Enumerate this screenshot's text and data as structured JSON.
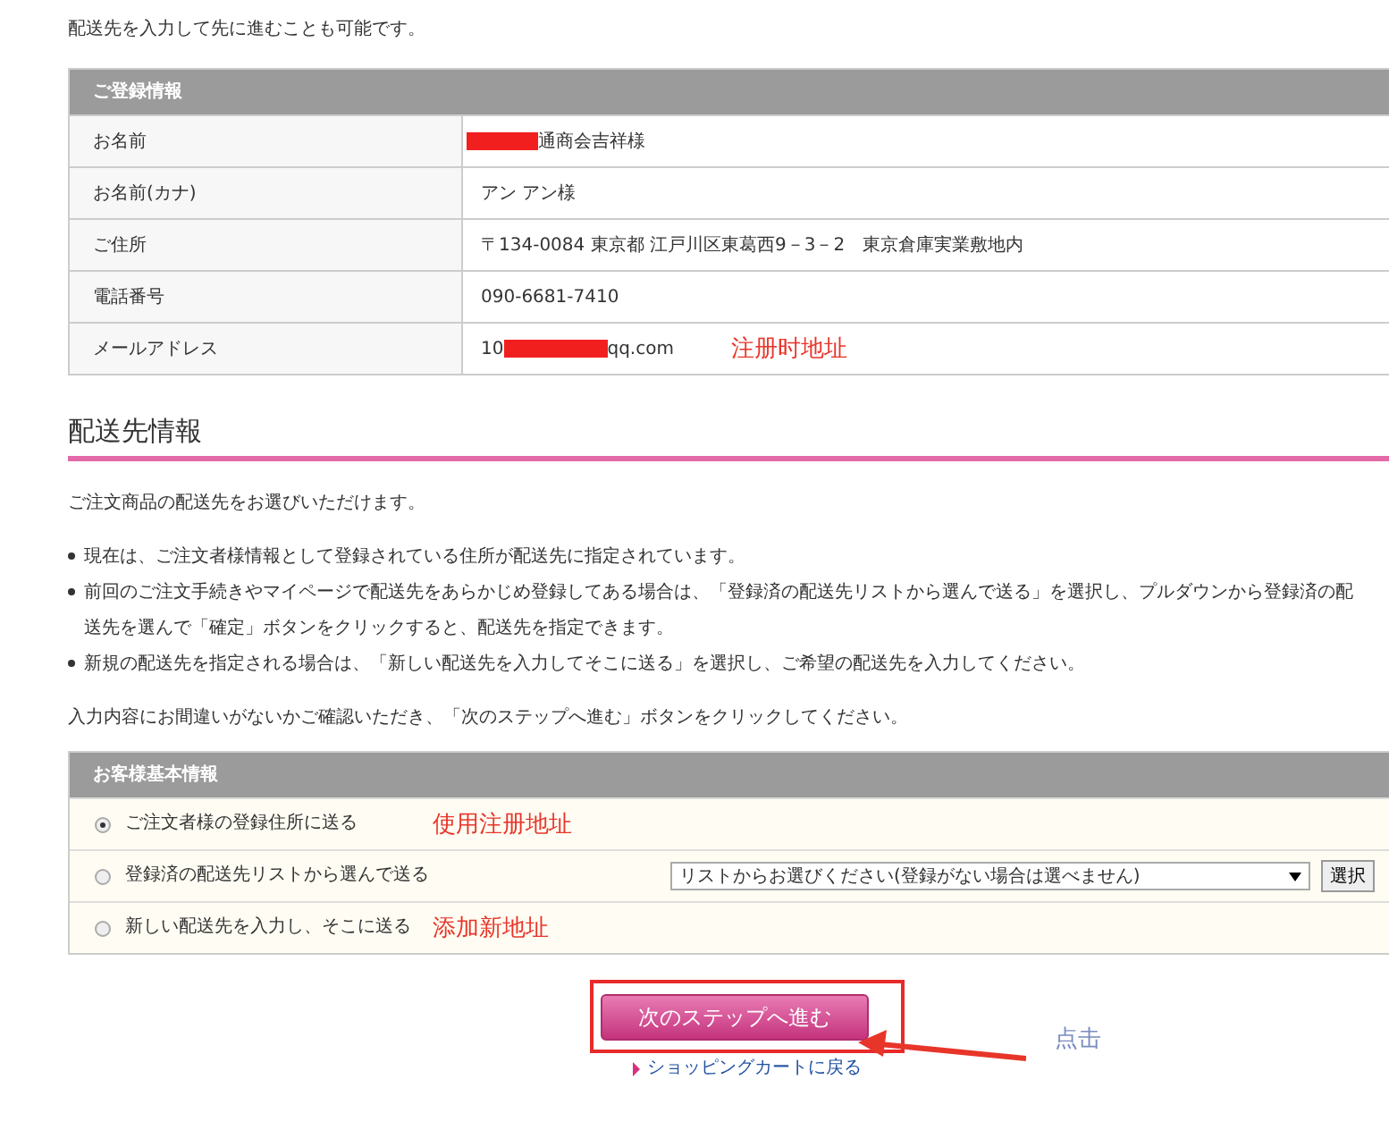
{
  "intro": "配送先を入力して先に進むことも可能です。",
  "registration": {
    "title": "ご登録情報",
    "rows": [
      {
        "label": "お名前",
        "redacted": true,
        "value": "通商会吉祥様"
      },
      {
        "label": "お名前(カナ)",
        "redacted": false,
        "value": "アン アン様"
      },
      {
        "label": "ご住所",
        "redacted": false,
        "value": "〒134-0084 東京都 江戸川区東葛西9－3－2　東京倉庫実業敷地内"
      },
      {
        "label": "電話番号",
        "redacted": false,
        "value": "090-6681-7410"
      },
      {
        "label": "メールアドレス",
        "prefix": "10",
        "redacted": true,
        "value": "qq.com",
        "note": "注册时地址"
      }
    ]
  },
  "shipping": {
    "heading": "配送先情報",
    "lead": "ご注文商品の配送先をお選びいただけます。",
    "bullets": [
      {
        "lines": [
          "現在は、ご注文者様情報として登録されている住所が配送先に指定されています。"
        ]
      },
      {
        "lines": [
          "前回のご注文手続きやマイページで配送先をあらかじめ登録してある場合は、「登録済の配送先リストから選んで送る」を選択し、プルダウンから登録済の配",
          "送先を選んで「確定」ボタンをクリックすると、配送先を指定できます。"
        ]
      },
      {
        "lines": [
          "新規の配送先を指定される場合は、「新しい配送先を入力してそこに送る」を選択し、ご希望の配送先を入力してください。"
        ]
      }
    ],
    "confirm": "入力内容にお間違いがないかご確認いただき、「次のステップへ進む」ボタンをクリックしてください。"
  },
  "options": {
    "title": "お客様基本情報",
    "items": [
      {
        "kind": "plain",
        "label": "ご注文者様の登録住所に送る",
        "selected": true,
        "note": "使用注册地址"
      },
      {
        "kind": "list",
        "label": "登録済の配送先リストから選んで送る",
        "selected": false,
        "dropdown": "リストからお選びください(登録がない場合は選べません)",
        "button": "選択"
      },
      {
        "kind": "plain",
        "label": "新しい配送先を入力し、そこに送る",
        "selected": false,
        "note": "添加新地址"
      }
    ]
  },
  "next_button": "次のステップへ進む",
  "click_note": "点击",
  "back_link": "ショッピングカートに戻る"
}
